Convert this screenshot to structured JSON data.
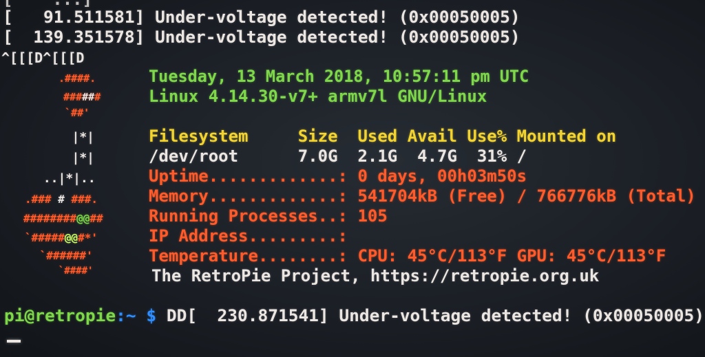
{
  "boot_log": [
    "[   91.511581] Under-voltage detected! (0x00050005)",
    "[  139.351578] Under-voltage detected! (0x00050005)",
    "^[[[D^[[[D"
  ],
  "header": {
    "datetime": "Tuesday, 13 March 2018, 10:57:11 pm UTC",
    "kernel": "Linux 4.14.30-v7+ armv7l GNU/Linux"
  },
  "filesystem": {
    "headers": [
      "Filesystem",
      "Size",
      "Used",
      "Avail",
      "Use%",
      "Mounted on"
    ],
    "row": {
      "fs": "/dev/root",
      "size": "7.0G",
      "used": "2.1G",
      "avail": "4.7G",
      "use": "31%",
      "mount": "/"
    }
  },
  "stats": [
    {
      "label": "Uptime.............:",
      "value": "0 days, 00h03m50s"
    },
    {
      "label": "Memory.............:",
      "value": "541704kB (Free) / 766776kB (Total)"
    },
    {
      "label": "Running Processes..:",
      "value": "105"
    },
    {
      "label": "IP Address.........:",
      "value": ""
    },
    {
      "label": "Temperature........:",
      "value": "CPU: 45°C/113°F GPU: 45°C/113°F"
    }
  ],
  "project": "The RetroPie Project, https://retropie.org.uk",
  "prompt": {
    "user_host": "pi@retropie",
    "cwd": ":~",
    "symbol": "$",
    "input": "DD[  230.871541] Under-voltage detected! (0x00050005)"
  },
  "logo": [
    " .####. ",
    "  ####  ",
    "  `##'  ",
    "   |*|  ",
    "   |*|  ",
    " ..|*|..",
    ".### # ###.",
    "########@@##",
    "`#####@@#*'",
    " `######'  ",
    "  `####'   "
  ],
  "colors": {
    "background": "#1a1e24",
    "text": "#ece6e2",
    "green": "#7fd84a",
    "yellow": "#f2d330",
    "red": "#ff5a2a",
    "blue": "#2f8eff"
  }
}
